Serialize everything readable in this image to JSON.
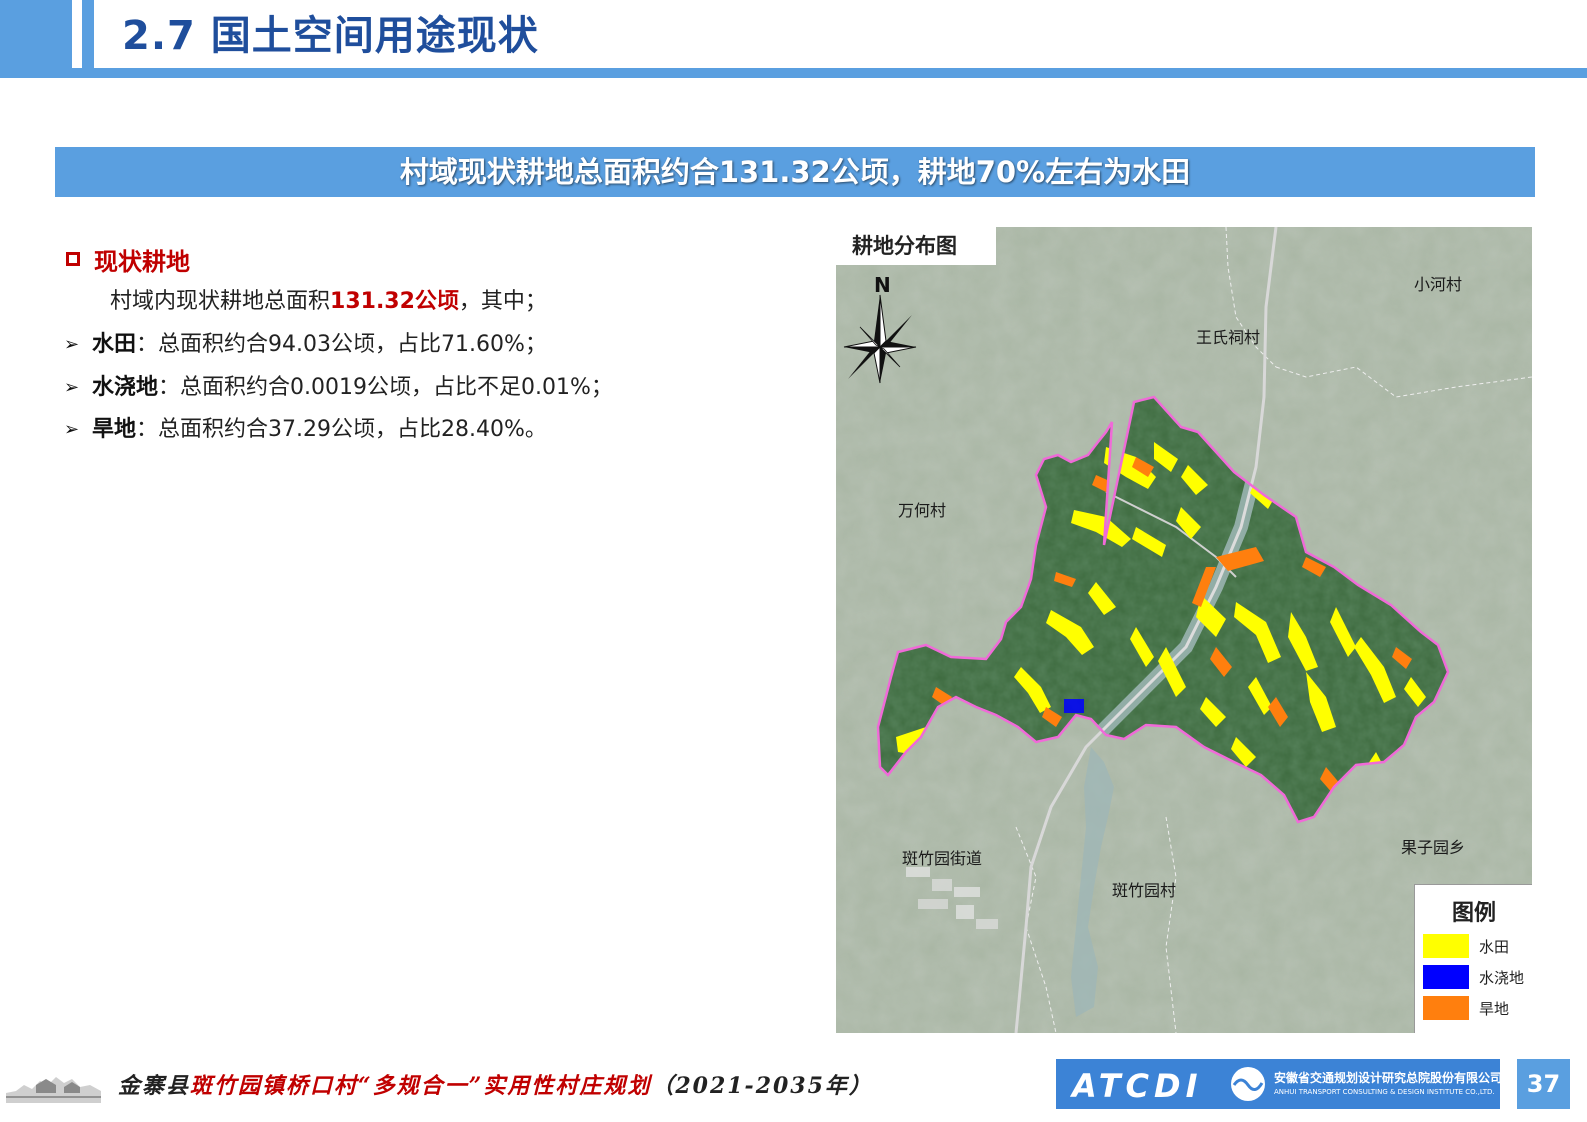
{
  "header": {
    "title": "2.7 国土空间用途现状"
  },
  "banner": {
    "text": "村域现状耕地总面积约合131.32公顷，耕地70%左右为水田"
  },
  "section": {
    "title": "现状耕地",
    "intro_pre": "村域内现状耕地总面积",
    "intro_highlight": "131.32公顷",
    "intro_post": "，其中；",
    "bullets": [
      {
        "term": "水田",
        "text": "：总面积约合94.03公顷，占比71.60%；"
      },
      {
        "term": "水浇地",
        "text": "：总面积约合0.0019公顷，占比不足0.01%；"
      },
      {
        "term": "旱地",
        "text": "：总面积约合37.29公顷，占比28.40%。"
      }
    ]
  },
  "map": {
    "title": "耕地分布图",
    "north": "N",
    "labels": {
      "xiaohe": "小河村",
      "wangshi": "王氏祠村",
      "wanhe": "万何村",
      "guoziyuan": "果子园乡",
      "banzhu_jd": "斑竹园街道",
      "banzhu_c": "斑竹园村"
    },
    "legend": {
      "title": "图例",
      "items": [
        {
          "label": "水田",
          "color": "#ffff00"
        },
        {
          "label": "水浇地",
          "color": "#0000ff"
        },
        {
          "label": "旱地",
          "color": "#ff7f0e"
        }
      ]
    },
    "colors": {
      "boundary": "#f06ad8",
      "terrain": "#a9b6a4",
      "forest": "#3d6a3e",
      "river": "#9fb7b6"
    }
  },
  "footer": {
    "text_a": "金寨县",
    "text_b": "斑竹园镇桥口村“多规合一”实用性村庄规划",
    "text_c": "（2021-2035年）",
    "logo_mark": "ATCDI",
    "logo_cn": "安徽省交通规划设计研究总院股份有限公司",
    "logo_en": "ANHUI TRANSPORT CONSULTING & DESIGN INSTITUTE CO.,LTD.",
    "page": "37"
  }
}
